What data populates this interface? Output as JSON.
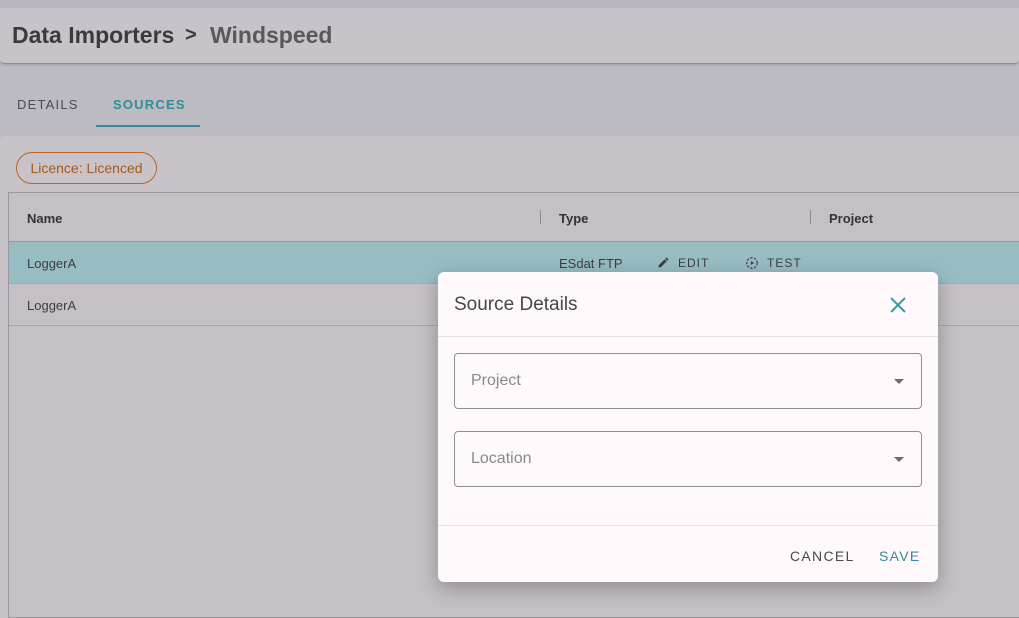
{
  "header": {
    "section": "Data Importers",
    "separator": ">",
    "title": "Windspeed"
  },
  "tabs": [
    {
      "label": "DETAILS"
    },
    {
      "label": "SOURCES"
    }
  ],
  "licence_chip": "Licence: Licenced",
  "table": {
    "columns": [
      "Name",
      "Type",
      "Project"
    ],
    "rows": [
      {
        "name": "LoggerA",
        "type": "ESdat FTP",
        "edit": "EDIT",
        "test": "TEST"
      },
      {
        "name": "LoggerA"
      }
    ]
  },
  "dialog": {
    "title": "Source Details",
    "project_placeholder": "Project",
    "location_placeholder": "Location",
    "cancel": "CANCEL",
    "save": "SAVE"
  },
  "colors": {
    "accent": "#2f8d99",
    "licence": "#b9661f",
    "selected_row": "#97bdc3"
  },
  "icons": [
    "pencil-icon",
    "test-play-icon",
    "close-icon",
    "dropdown-arrow-icon"
  ]
}
